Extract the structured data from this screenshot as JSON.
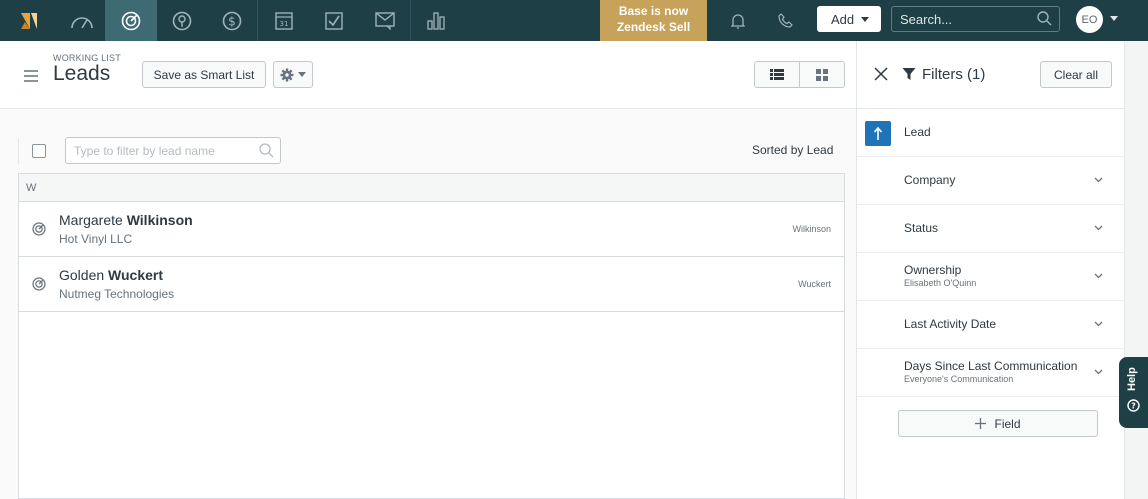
{
  "topnav": {
    "promo_line1": "Base is now",
    "promo_line2": "Zendesk Sell",
    "add_label": "Add",
    "search_placeholder": "Search...",
    "avatar_initials": "EO",
    "icons": [
      "logo-icon",
      "dashboard-icon",
      "leads-icon",
      "contacts-icon",
      "deals-icon",
      "calendar-icon",
      "tasks-icon",
      "communication-icon",
      "reports-icon",
      "bell-icon",
      "phone-icon"
    ]
  },
  "header": {
    "eyebrow": "WORKING LIST",
    "title": "Leads",
    "smart_list_label": "Save as Smart List"
  },
  "list": {
    "filter_placeholder": "Type to filter by lead name",
    "sorted_label": "Sorted by Lead",
    "group_letter": "W",
    "rows": [
      {
        "first": "Margarete",
        "last": "Wilkinson",
        "company": "Hot Vinyl LLC",
        "sort_value": "Wilkinson"
      },
      {
        "first": "Golden",
        "last": "Wuckert",
        "company": "Nutmeg Technologies",
        "sort_value": "Wuckert"
      }
    ]
  },
  "filters": {
    "title": "Filters (1)",
    "clear_label": "Clear all",
    "items": [
      {
        "label": "Lead",
        "sub": ""
      },
      {
        "label": "Company",
        "sub": ""
      },
      {
        "label": "Status",
        "sub": ""
      },
      {
        "label": "Ownership",
        "sub": "Elisabeth O'Quinn"
      },
      {
        "label": "Last Activity Date",
        "sub": ""
      },
      {
        "label": "Days Since Last Communication",
        "sub": "Everyone's Communication"
      }
    ],
    "add_field_label": "Field"
  },
  "help": {
    "label": "Help"
  },
  "colors": {
    "nav_bg": "#1f3f47",
    "nav_active": "#3d6a73",
    "promo": "#c7a25a",
    "logo": "#e8a33d",
    "sort_badge": "#1f73b7"
  }
}
